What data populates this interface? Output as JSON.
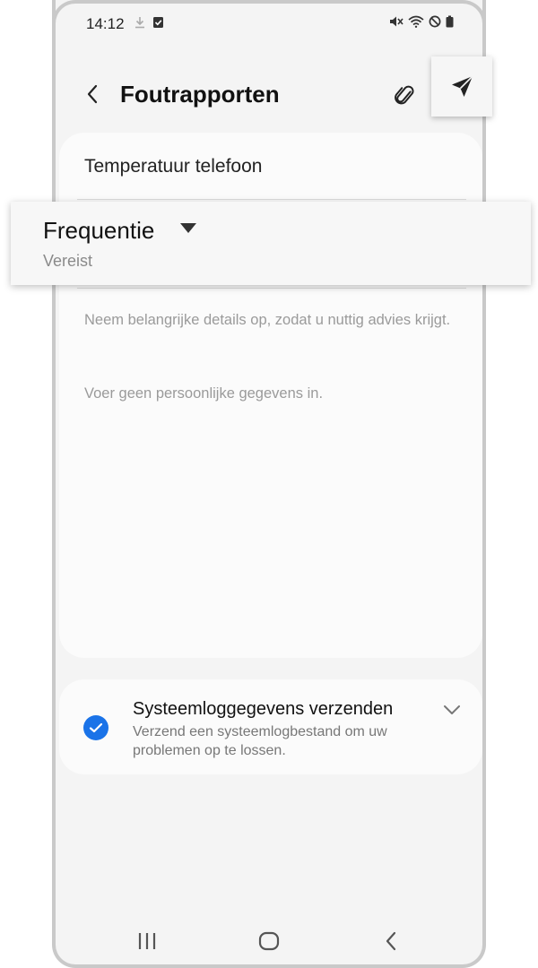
{
  "status_bar": {
    "time": "14:12",
    "left_icons": [
      "download-icon",
      "task-check-icon"
    ],
    "right_icons": [
      "mute-icon",
      "wifi-icon",
      "do-not-disturb-icon",
      "battery-icon"
    ]
  },
  "app_bar": {
    "title": "Foutrapporten",
    "back_icon": "back-arrow-icon",
    "attach_icon": "paperclip-icon",
    "send_icon": "send-icon"
  },
  "form": {
    "subject_value": "Temperatuur telefoon",
    "frequency": {
      "label": "Frequentie",
      "required_text": "Vereist"
    },
    "hint_line1": "Neem belangrijke details op, zodat u nuttig advies krijgt.",
    "hint_line2": "Voer geen persoonlijke gegevens in."
  },
  "system_log": {
    "checked": true,
    "title": "Systeemloggegevens verzenden",
    "description": "Verzend een systeemlogbestand om uw problemen op te lossen."
  },
  "nav_bar": {
    "items": [
      "recent-apps-icon",
      "home-icon",
      "back-icon"
    ]
  },
  "colors": {
    "accent": "#1a73e8",
    "background": "#f4f4f4",
    "card": "#fbfbfb"
  }
}
